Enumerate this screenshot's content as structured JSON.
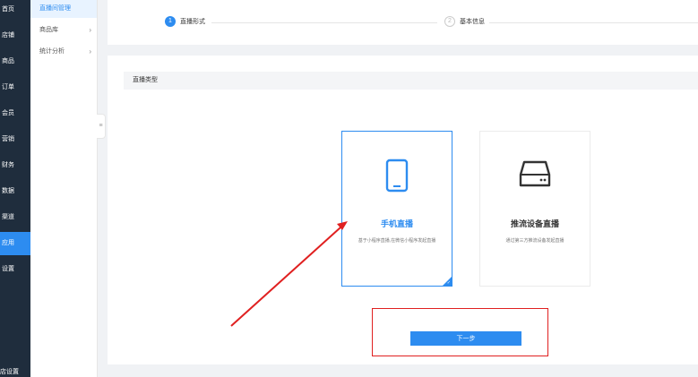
{
  "nav": {
    "items": [
      {
        "label": "首页",
        "active": false
      },
      {
        "label": "店铺",
        "active": false
      },
      {
        "label": "商品",
        "active": false
      },
      {
        "label": "订单",
        "active": false
      },
      {
        "label": "会员",
        "active": false
      },
      {
        "label": "营销",
        "active": false
      },
      {
        "label": "财务",
        "active": false
      },
      {
        "label": "数据",
        "active": false
      },
      {
        "label": "渠道",
        "active": false
      },
      {
        "label": "应用",
        "active": true
      },
      {
        "label": "设置",
        "active": false
      }
    ],
    "bottom_label": "店设置"
  },
  "submenu": {
    "items": [
      {
        "label": "直播间管理",
        "active": true,
        "has_chevron": false
      },
      {
        "label": "商品库",
        "active": false,
        "has_chevron": true
      },
      {
        "label": "统计分析",
        "active": false,
        "has_chevron": true
      }
    ],
    "collapse_icon": "≡"
  },
  "steps": {
    "items": [
      {
        "number": "1",
        "label": "直播形式",
        "active": true
      },
      {
        "number": "2",
        "label": "基本信息",
        "active": false
      }
    ]
  },
  "main": {
    "section_title": "直播类型",
    "options": [
      {
        "icon": "phone-icon",
        "title": "手机直播",
        "description": "基于小程序直播,在微信小程序发起直播",
        "selected": true
      },
      {
        "icon": "device-icon",
        "title": "推流设备直播",
        "description": "通过第三方推流设备发起直播",
        "selected": false
      }
    ],
    "next_label": "下一步"
  },
  "colors": {
    "accent": "#2d8cf0",
    "nav_bg": "#1f2d3d",
    "annotation_red": "#e02020"
  }
}
